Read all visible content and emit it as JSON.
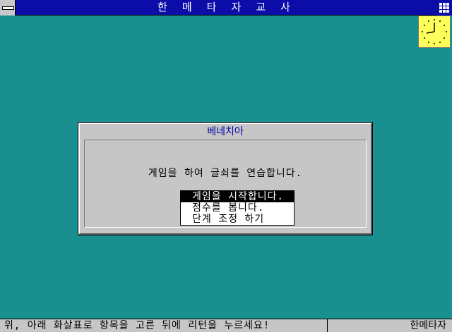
{
  "window": {
    "title": "한 메 타 자 교 사",
    "system_menu_icon": "system-menu-icon",
    "grid_icon": "grid-icon"
  },
  "clock": {
    "icon": "clock-icon",
    "background": "#ffff5a"
  },
  "dialog": {
    "title": "베네치아",
    "message": "게임을 하여 글쇠를 연습합니다.",
    "menu": [
      {
        "label": "게임을 시작합니다.",
        "selected": true
      },
      {
        "label": "점수를 봅니다.",
        "selected": false
      },
      {
        "label": "단계 조정 하기",
        "selected": false
      }
    ]
  },
  "status": {
    "hint": "위, 아래 화살표로 항목을 고른 뒤에 리턴을 누르세요!",
    "app_name": "한메타자"
  },
  "colors": {
    "desktop": "#1a8f8f",
    "titlebar": "#0c0ca8",
    "dialog_title": "#0000a8"
  }
}
